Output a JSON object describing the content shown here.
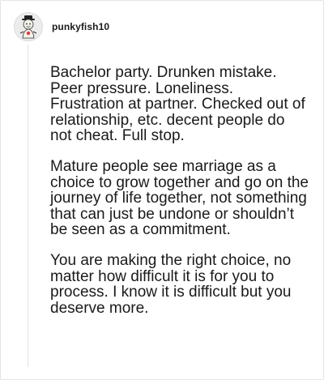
{
  "comment": {
    "author": {
      "username": "punkyfish10",
      "avatar_icon": "cartoon-character-avatar-icon"
    },
    "paragraphs": [
      "Bachelor party. Drunken mistake. Peer pressure. Loneliness. Frustration at partner. Checked out of relationship, etc. decent people do not cheat. Full stop.",
      "Mature people see marriage as a choice to grow together and go on the journey of life together, not something that can just be undone or shouldn’t be seen as a commitment.",
      "You are making the right choice, no matter how difficult it is for you to process. I know it is difficult but you deserve more."
    ]
  }
}
